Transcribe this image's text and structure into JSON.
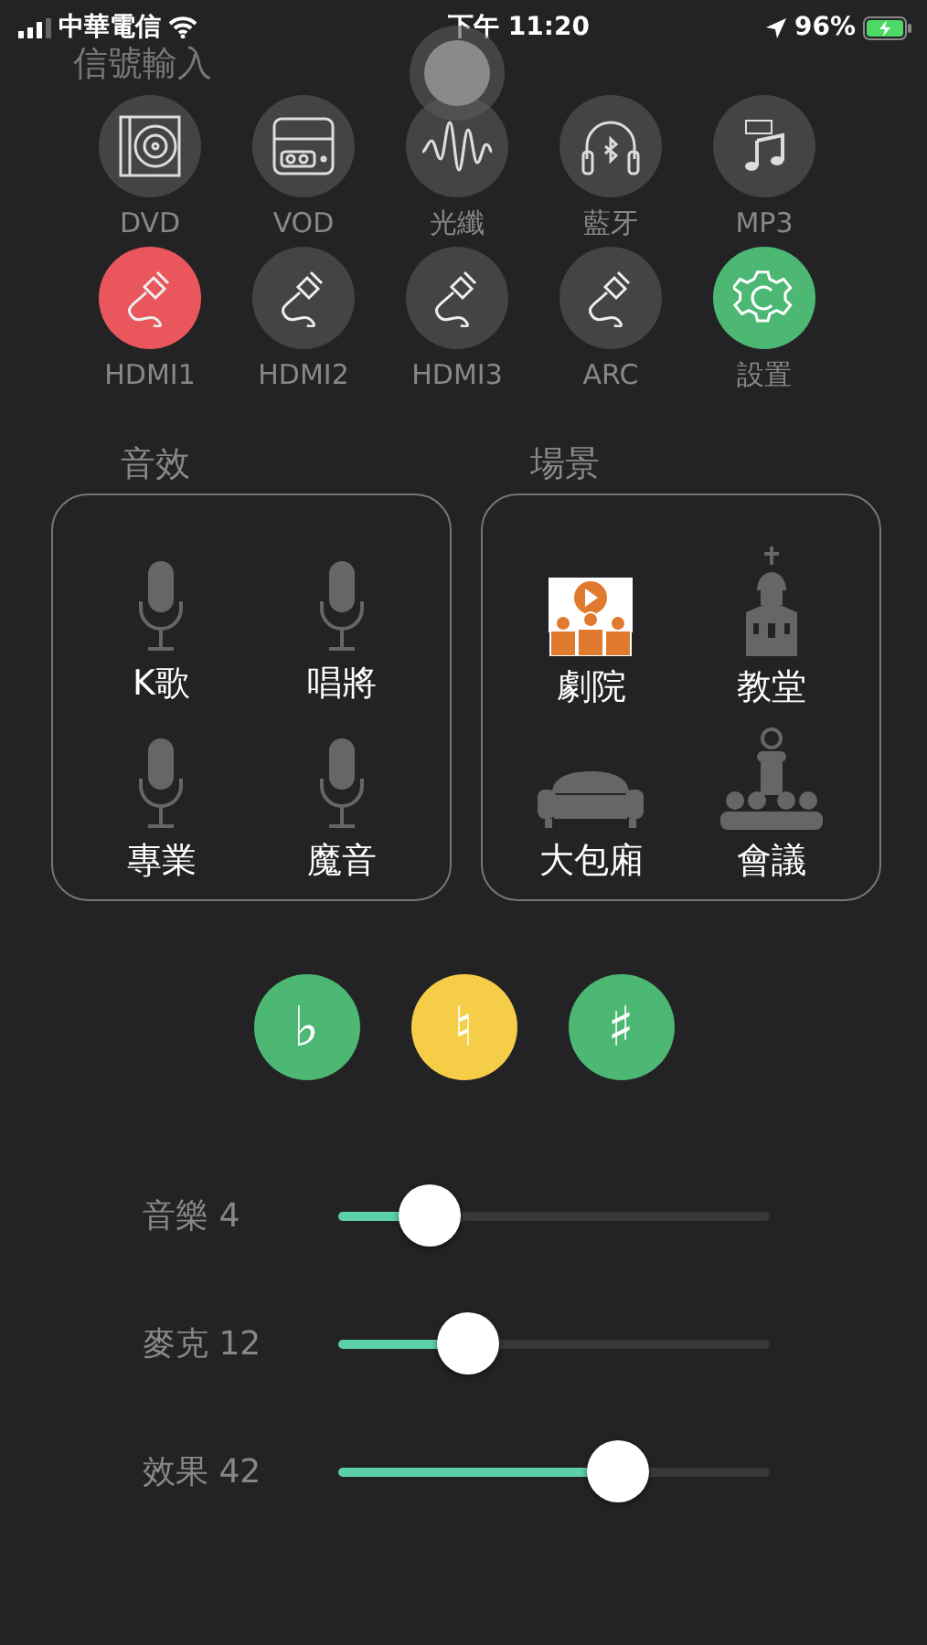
{
  "status_bar": {
    "carrier": "中華電信",
    "time": "下午 11:20",
    "battery": "96%"
  },
  "source_section": {
    "title": "信號輸入",
    "sources": [
      {
        "label": "DVD",
        "kind": "disc",
        "selected": false
      },
      {
        "label": "VOD",
        "kind": "player",
        "selected": false
      },
      {
        "label": "光纖",
        "kind": "wave",
        "selected": false
      },
      {
        "label": "藍牙",
        "kind": "headphones",
        "selected": false
      },
      {
        "label": "MP3",
        "kind": "music",
        "selected": false
      },
      {
        "label": "HDMI1",
        "kind": "cable",
        "selected": true
      },
      {
        "label": "HDMI2",
        "kind": "cable",
        "selected": false
      },
      {
        "label": "HDMI3",
        "kind": "cable",
        "selected": false
      },
      {
        "label": "ARC",
        "kind": "cable",
        "selected": false
      },
      {
        "label": "設置",
        "kind": "settings",
        "selected": false
      }
    ]
  },
  "effects": {
    "title": "音效",
    "items": [
      {
        "label": "K歌"
      },
      {
        "label": "唱將"
      },
      {
        "label": "專業"
      },
      {
        "label": "魔音"
      }
    ]
  },
  "scenes": {
    "title": "場景",
    "items": [
      {
        "label": "劇院",
        "kind": "theater",
        "selected": true
      },
      {
        "label": "教堂",
        "kind": "church",
        "selected": false
      },
      {
        "label": "大包廂",
        "kind": "sofa",
        "selected": false
      },
      {
        "label": "會議",
        "kind": "meeting",
        "selected": false
      }
    ]
  },
  "tones": [
    {
      "label": "♭",
      "selected": false
    },
    {
      "label": "♮",
      "selected": true
    },
    {
      "label": "♯",
      "selected": false
    }
  ],
  "sliders": [
    {
      "label": "音樂 4",
      "level": 0.21
    },
    {
      "label": "麥克 12",
      "level": 0.3
    },
    {
      "label": "效果 42",
      "level": 0.65
    }
  ]
}
